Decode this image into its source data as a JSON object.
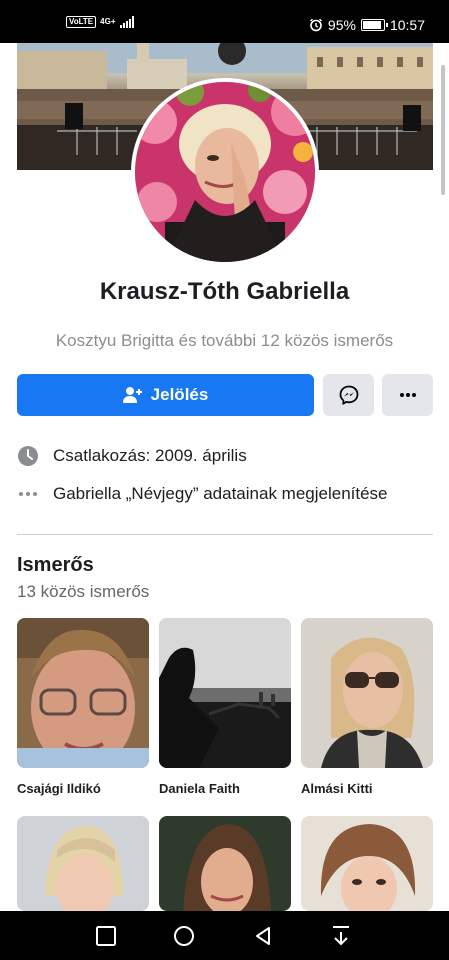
{
  "status_bar": {
    "volte": "VoLTE",
    "network": "4G+",
    "battery_percent": "95%",
    "battery_level": 0.95,
    "time": "10:57",
    "icons": [
      "volte-icon",
      "signal-icon",
      "alarm-icon",
      "battery-icon"
    ]
  },
  "profile": {
    "name": "Krausz-Tóth Gabriella",
    "mutual_friends": "Kosztyu Brigitta és további 12 közös ismerős"
  },
  "actions": {
    "primary_label": "Jelölés",
    "primary_icon": "add-friend-icon",
    "messenger_icon": "messenger-icon",
    "more_icon": "more-dots-icon",
    "accent_color": "#1877f2"
  },
  "info": {
    "joined": "Csatlakozás: 2009. április",
    "about": "Gabriella „Névjegy” adatainak megjelenítése"
  },
  "friends": {
    "title": "Ismerős",
    "subtitle": "13 közös ismerős",
    "items": [
      {
        "name": "Csajági Ildikó"
      },
      {
        "name": "Daniela Faith"
      },
      {
        "name": "Almási Kitti"
      },
      {
        "name": ""
      },
      {
        "name": ""
      },
      {
        "name": ""
      }
    ]
  },
  "nav": {
    "icons": [
      "recent-apps-icon",
      "home-icon",
      "back-icon",
      "notification-pull-icon"
    ]
  }
}
